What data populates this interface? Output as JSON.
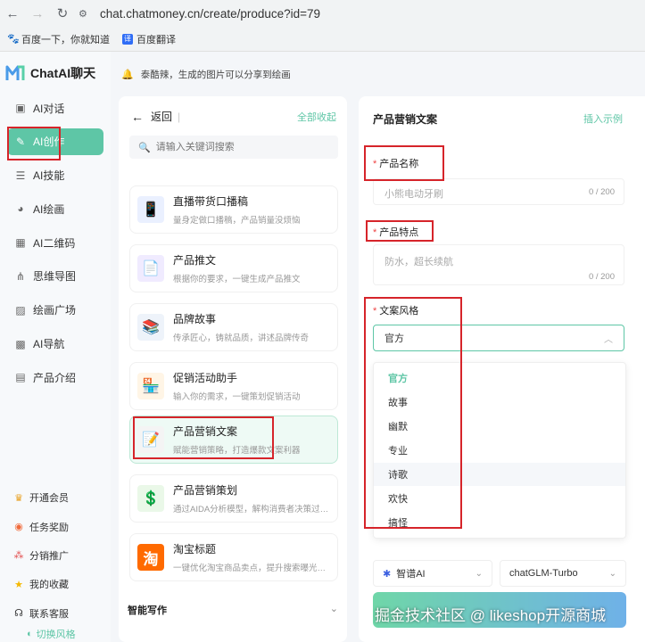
{
  "browser": {
    "url": "chat.chatmoney.cn/create/produce?id=79",
    "bookmarks": [
      {
        "label": "百度一下，你就知道"
      },
      {
        "label": "百度翻译"
      }
    ]
  },
  "sidebar": {
    "brand": "ChatAI聊天",
    "items": [
      {
        "label": "AI对话",
        "icon": "chat-icon"
      },
      {
        "label": "AI创作",
        "icon": "pen-icon",
        "active": true
      },
      {
        "label": "AI技能",
        "icon": "list-icon"
      },
      {
        "label": "AI绘画",
        "icon": "palette-icon"
      },
      {
        "label": "AI二维码",
        "icon": "qrcode-icon"
      },
      {
        "label": "思维导图",
        "icon": "mindmap-icon"
      },
      {
        "label": "绘画广场",
        "icon": "image-icon"
      },
      {
        "label": "AI导航",
        "icon": "grid-icon"
      },
      {
        "label": "产品介绍",
        "icon": "doc-icon"
      }
    ],
    "bottom": [
      {
        "label": "开通会员",
        "icon": "crown-icon"
      },
      {
        "label": "任务奖励",
        "icon": "gift-icon"
      },
      {
        "label": "分销推广",
        "icon": "share-icon"
      },
      {
        "label": "我的收藏",
        "icon": "star-icon"
      },
      {
        "label": "联系客服",
        "icon": "headset-icon"
      }
    ],
    "switch_style": "切换风格"
  },
  "notice": "泰酷辣，生成的图片可以分享到绘画",
  "middle": {
    "back_label": "返回",
    "collapse_all": "全部收起",
    "search_placeholder": "请输入关键词搜索",
    "cards": [
      {
        "title": "直播带货口播稿",
        "desc": "量身定做口播稿，产品销量没烦恼"
      },
      {
        "title": "产品推文",
        "desc": "根据你的要求，一键生成产品推文"
      },
      {
        "title": "品牌故事",
        "desc": "传承匠心，铸就品质，讲述品牌传奇"
      },
      {
        "title": "促销活动助手",
        "desc": "输入你的需求，一键策划促销活动"
      },
      {
        "title": "产品营销文案",
        "desc": "赋能营销策略，打造爆款文案利器"
      },
      {
        "title": "产品营销策划",
        "desc": "通过AIDA分析模型，解构消费者决策过…"
      },
      {
        "title": "淘宝标题",
        "desc": "一键优化淘宝商品卖点，提升搜索曝光…"
      }
    ],
    "section_title": "智能写作"
  },
  "right": {
    "title": "产品营销文案",
    "example_label": "插入示例",
    "name_label": "产品名称",
    "name_placeholder": "小熊电动牙刷",
    "name_count": "0 / 200",
    "feature_label": "产品特点",
    "feature_placeholder": "防水，超长续航",
    "feature_count": "0 / 200",
    "style_label": "文案风格",
    "style_value": "官方",
    "style_options": [
      "官方",
      "故事",
      "幽默",
      "专业",
      "诗歌",
      "欢快",
      "搞怪"
    ],
    "model_provider": "智谱AI",
    "model_name": "chatGLM-Turbo"
  },
  "watermark": "掘金技术社区 @ likeshop开源商城"
}
